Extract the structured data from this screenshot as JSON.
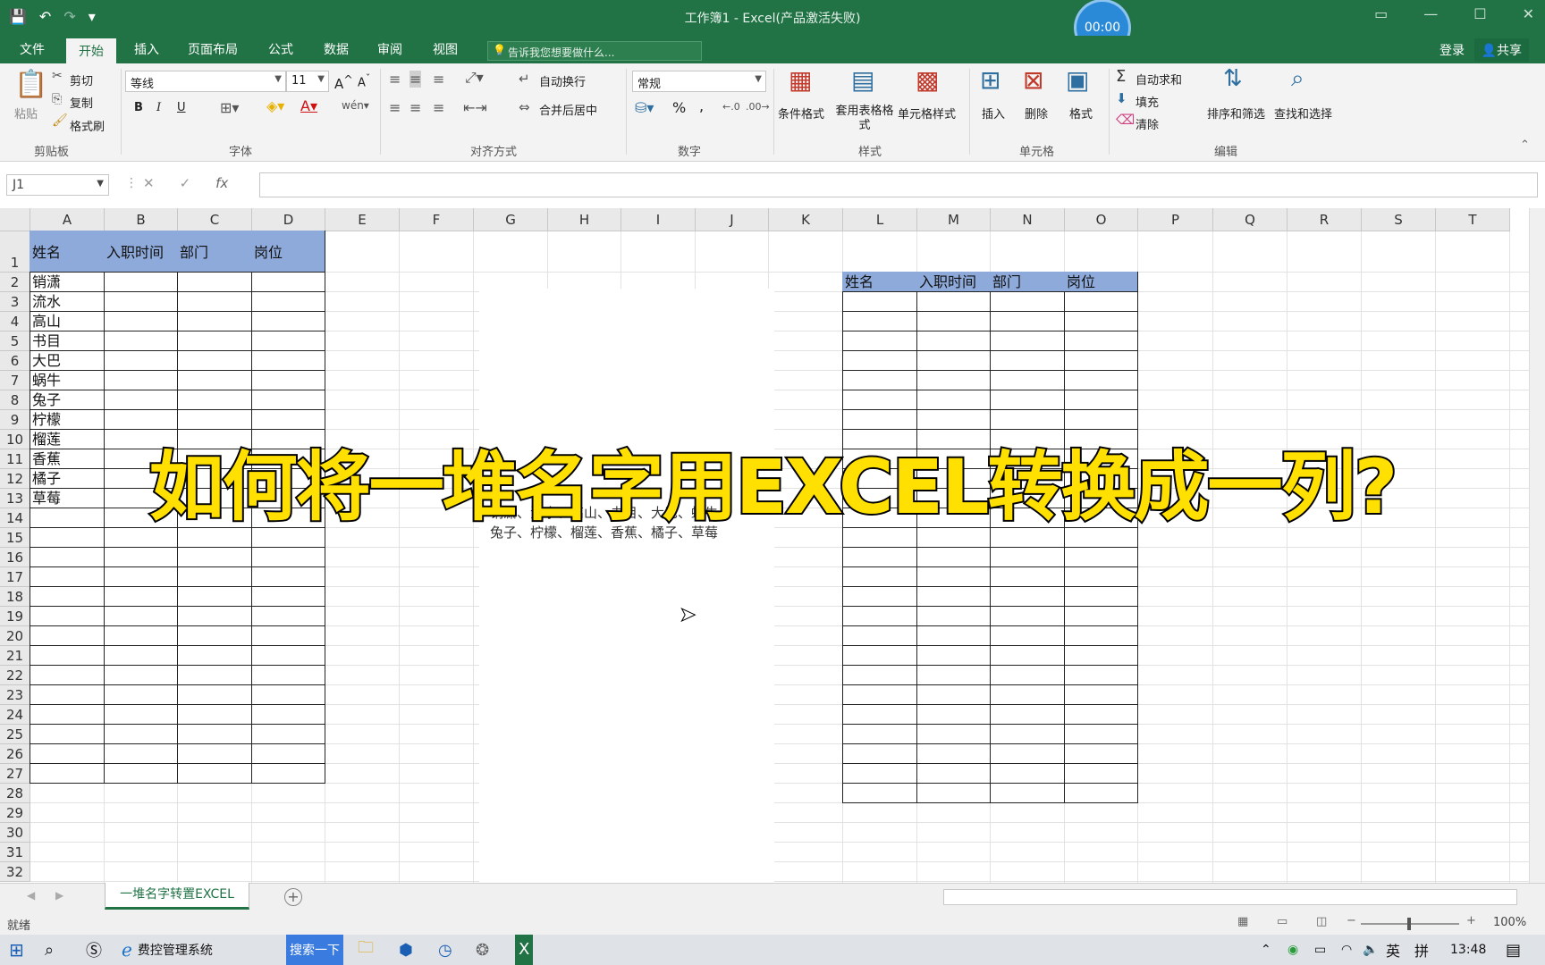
{
  "titlebar": {
    "title": "工作簿1 - Excel(产品激活失败)",
    "timer": "00:00",
    "qat": [
      "💾",
      "↶",
      "↷",
      "▾"
    ]
  },
  "menubar": {
    "tabs": [
      "文件",
      "开始",
      "插入",
      "页面布局",
      "公式",
      "数据",
      "审阅",
      "视图"
    ],
    "active": "开始",
    "tellme": "告诉我您想要做什么...",
    "login": "登录",
    "share": "共享"
  },
  "ribbon": {
    "clipboard": {
      "paste": "粘贴",
      "cut": "剪切",
      "copy": "复制",
      "format_painter": "格式刷",
      "group": "剪贴板"
    },
    "font": {
      "name": "等线",
      "size": "11",
      "group": "字体",
      "bold": "B",
      "italic": "I",
      "underline": "U"
    },
    "alignment": {
      "wrap": "自动换行",
      "merge": "合并后居中",
      "group": "对齐方式"
    },
    "number": {
      "format": "常规",
      "percent": "%",
      "comma": ",",
      "group": "数字"
    },
    "styles": {
      "conditional": "条件格式",
      "table": "套用表格格式",
      "cell_styles": "单元格样式",
      "group": "样式"
    },
    "cells": {
      "insert": "插入",
      "delete": "删除",
      "format": "格式",
      "group": "单元格"
    },
    "editing": {
      "autosum": "自动求和",
      "fill": "填充",
      "clear": "清除",
      "sort": "排序和筛选",
      "find": "查找和选择",
      "group": "编辑"
    }
  },
  "formula": {
    "namebox": "J1",
    "fx": "fx"
  },
  "columns": [
    "A",
    "B",
    "C",
    "D",
    "E",
    "F",
    "G",
    "H",
    "I",
    "J",
    "K",
    "L",
    "M",
    "N",
    "O",
    "P",
    "Q",
    "R",
    "S",
    "T"
  ],
  "rows": [
    "1",
    "2",
    "3",
    "4",
    "5",
    "6",
    "7",
    "8",
    "9",
    "10",
    "11",
    "12",
    "13",
    "14",
    "15",
    "16",
    "17",
    "18",
    "19",
    "20",
    "21",
    "22",
    "23",
    "24",
    "25",
    "26",
    "27",
    "28",
    "29",
    "30",
    "31",
    "32"
  ],
  "table1": {
    "headers": [
      "姓名",
      "入职时间",
      "部门",
      "岗位"
    ],
    "names": [
      "销潇",
      "流水",
      "高山",
      "书目",
      "大巴",
      "蜗牛",
      "兔子",
      "柠檬",
      "榴莲",
      "香蕉",
      "橘子",
      "草莓"
    ]
  },
  "table2": {
    "headers": [
      "姓名",
      "入职时间",
      "部门",
      "岗位"
    ]
  },
  "textbox": {
    "line1": "销潇、流水、高山、书目、大巴、蜗牛、",
    "line2": "兔子、柠檬、榴莲、香蕉、橘子、草莓"
  },
  "overlay": {
    "title": "如何将一堆名字用EXCEL转换成一列?"
  },
  "sheet": {
    "tab": "一堆名字转置EXCEL"
  },
  "status": {
    "ready": "就绪",
    "zoom": "100%"
  },
  "taskbar": {
    "app1": "费控管理系统",
    "search": "搜索一下",
    "lang": "英",
    "ime": "拼",
    "time": "13:48"
  }
}
